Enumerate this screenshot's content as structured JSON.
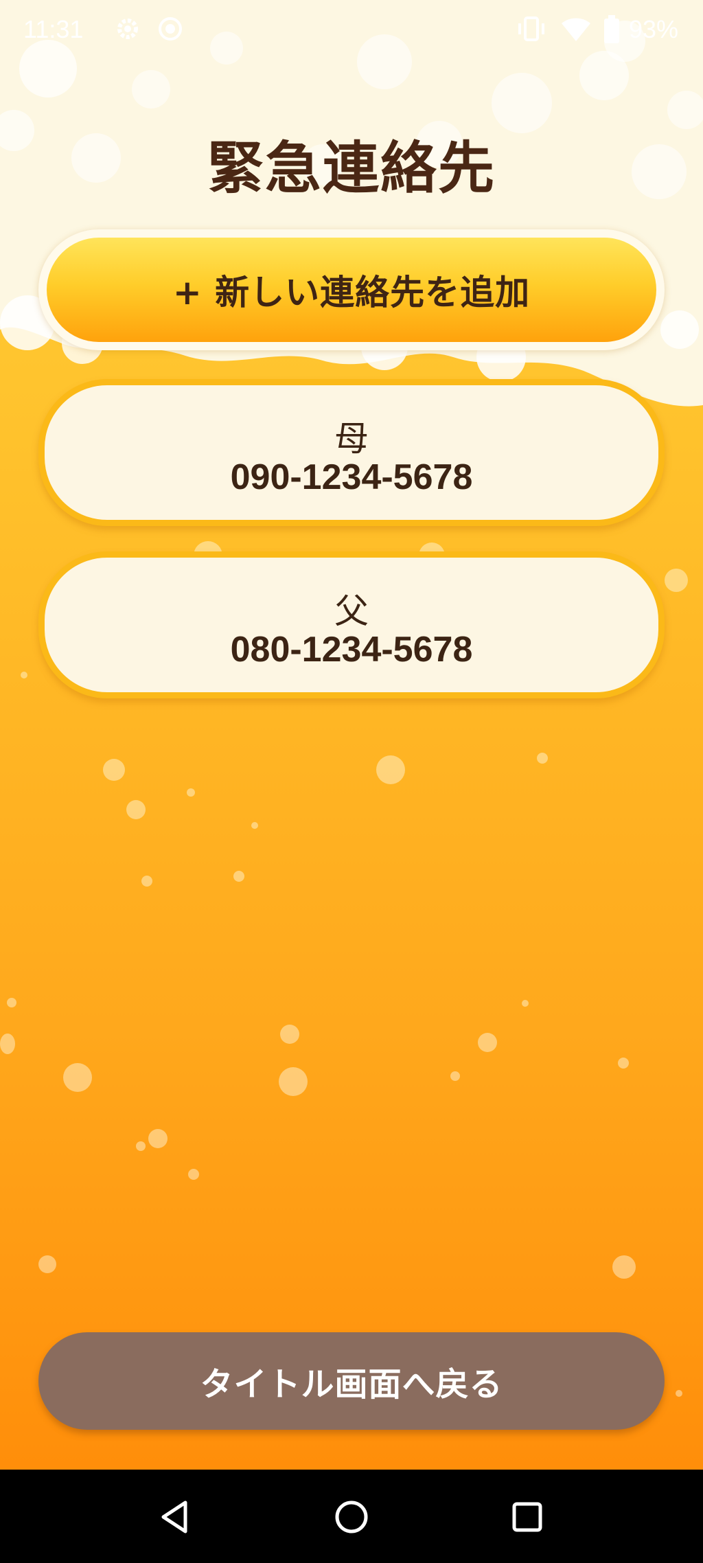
{
  "status_bar": {
    "time": "11:31",
    "battery": "93%",
    "icons": [
      "gear-icon",
      "record-icon",
      "vibrate-icon",
      "wifi-icon",
      "battery-icon"
    ]
  },
  "page": {
    "title": "緊急連絡先"
  },
  "add_button": {
    "label": "+ 新しい連絡先を追加"
  },
  "contacts": [
    {
      "name": "母",
      "phone": "090-1234-5678"
    },
    {
      "name": "父",
      "phone": "080-1234-5678"
    }
  ],
  "back_button": {
    "label": "タイトル画面へ戻る"
  },
  "nav_bar": {
    "icons": [
      "back-icon",
      "home-icon",
      "recents-icon"
    ]
  },
  "colors": {
    "background_top": "#ffd23a",
    "background_bottom": "#ff8e0a",
    "title_text": "#4a2714",
    "card_border": "#fbb918",
    "back_button": "#8a6c5e"
  }
}
